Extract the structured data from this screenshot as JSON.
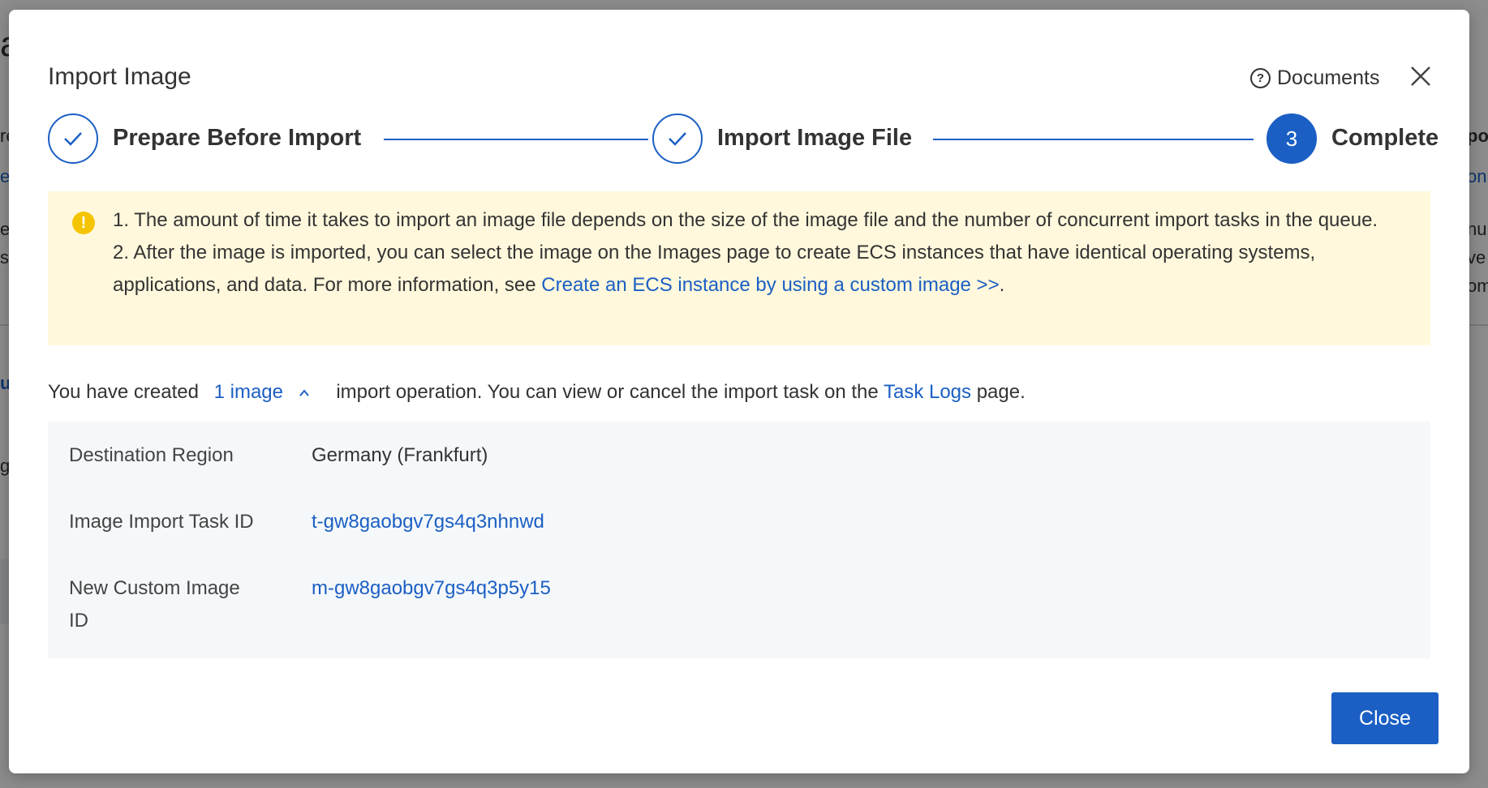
{
  "background": {
    "fragments": [
      "a",
      "re",
      "e",
      "e",
      "st",
      "us",
      "g",
      "l",
      "po",
      "on",
      "nu",
      "ve",
      "om"
    ]
  },
  "modal": {
    "title": "Import Image",
    "documents_label": "Documents",
    "steps": [
      {
        "label": "Prepare Before Import",
        "status": "done"
      },
      {
        "label": "Import Image File",
        "status": "done"
      },
      {
        "label": "Complete",
        "status": "active",
        "number": "3"
      }
    ],
    "alert": {
      "line1": "1. The amount of time it takes to import an image file depends on the size of the image file and the number of concurrent import tasks in the queue.",
      "line2_prefix": "2. After the image is imported, you can select the image on the Images page to create ECS instances that have identical operating systems, applications, and data. For more information, see ",
      "line2_link": "Create an ECS instance by using a custom image >>",
      "line2_suffix": "."
    },
    "created": {
      "prefix": "You have created",
      "count_link": "1 image",
      "middle": "import operation. You can view or cancel the import task on the",
      "task_logs_link": "Task Logs",
      "suffix": "page."
    },
    "details": [
      {
        "key": "Destination Region",
        "value": "Germany (Frankfurt)",
        "is_link": false
      },
      {
        "key": "Image Import Task ID",
        "value": "t-gw8gaobgv7gs4q3nhnwd",
        "is_link": true
      },
      {
        "key": "New Custom Image ID",
        "value": "m-gw8gaobgv7gs4q3p5y15",
        "is_link": true
      }
    ],
    "close_button": "Close"
  },
  "colors": {
    "primary": "#1b5fc4",
    "alert_bg": "#fff8dc",
    "alert_icon": "#f5c400",
    "details_bg": "#f5f8fa"
  }
}
